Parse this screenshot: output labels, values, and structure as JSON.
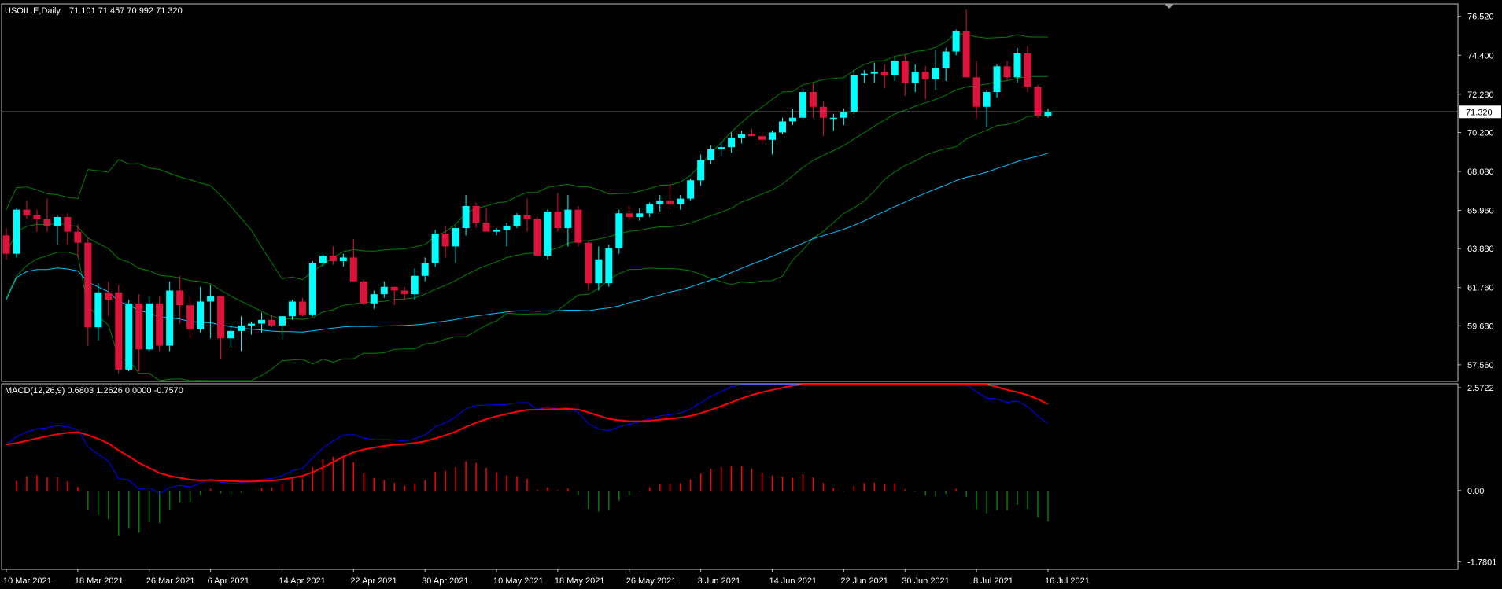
{
  "header": {
    "symbol": "USOIL.E,Daily",
    "ohlc": "71.101 71.457 70.992 71.320"
  },
  "macd_header": {
    "label": "MACD(12,26,9) 0.6803 1.2626 0.0000 -0.7570"
  },
  "colors": {
    "background": "#000000",
    "bull_candle": "#00ffff",
    "bear_candle": "#dc143c",
    "bands": "#008000",
    "ma": "#00bfff",
    "macd_line": "#0000ff",
    "signal_line": "#ff0000",
    "hist_pos": "#ff0000",
    "hist_neg": "#008000",
    "price_line": "#c0c0c0"
  },
  "chart_data": [
    {
      "type": "candlestick",
      "title": "USOIL.E,Daily",
      "price_axis_ticks": [
        "76.520",
        "74.400",
        "72.280",
        "70.200",
        "68.080",
        "65.960",
        "63.880",
        "61.760",
        "59.680",
        "57.560"
      ],
      "ylim": [
        56.7,
        77.15
      ],
      "current_price": "71.320",
      "date_labels": [
        "10 Mar 2021",
        "18 Mar 2021",
        "26 Mar 2021",
        "6 Apr 2021",
        "14 Apr 2021",
        "22 Apr 2021",
        "30 Apr 2021",
        "10 May 2021",
        "18 May 2021",
        "26 May 2021",
        "3 Jun 2021",
        "14 Jun 2021",
        "22 Jun 2021",
        "30 Jun 2021",
        "8 Jul 2021",
        "16 Jul 2021"
      ],
      "candles": [
        [
          64.6,
          65.0,
          63.3,
          63.6
        ],
        [
          63.6,
          66.1,
          63.4,
          66.0
        ],
        [
          66.0,
          66.5,
          65.5,
          65.7
        ],
        [
          65.7,
          66.0,
          64.8,
          65.5
        ],
        [
          65.5,
          66.6,
          64.8,
          65.1
        ],
        [
          65.1,
          65.7,
          64.1,
          65.6
        ],
        [
          65.6,
          65.8,
          64.1,
          64.8
        ],
        [
          64.8,
          65.2,
          63.4,
          64.2
        ],
        [
          64.2,
          64.5,
          58.6,
          59.6
        ],
        [
          59.6,
          62.0,
          58.9,
          61.5
        ],
        [
          61.5,
          62.1,
          60.2,
          61.1
        ],
        [
          61.5,
          61.9,
          57.1,
          57.3
        ],
        [
          57.3,
          61.1,
          57.2,
          60.9
        ],
        [
          60.9,
          61.4,
          57.2,
          58.4
        ],
        [
          58.4,
          61.3,
          58.3,
          60.9
        ],
        [
          60.9,
          61.3,
          58.3,
          58.6
        ],
        [
          58.6,
          62.1,
          58.3,
          61.6
        ],
        [
          61.6,
          62.4,
          59.8,
          60.8
        ],
        [
          60.8,
          61.3,
          59.0,
          59.5
        ],
        [
          59.5,
          61.8,
          59.3,
          61.0
        ],
        [
          61.0,
          61.9,
          59.0,
          61.3
        ],
        [
          61.3,
          61.3,
          57.9,
          59.0
        ],
        [
          59.0,
          59.7,
          58.5,
          59.4
        ],
        [
          59.4,
          60.2,
          58.3,
          59.7
        ],
        [
          59.7,
          59.9,
          59.2,
          59.8
        ],
        [
          59.8,
          60.4,
          59.3,
          60.0
        ],
        [
          60.0,
          60.3,
          59.6,
          59.7
        ],
        [
          59.7,
          60.2,
          59.0,
          60.2
        ],
        [
          60.2,
          61.1,
          60.0,
          61.0
        ],
        [
          61.0,
          61.2,
          60.2,
          60.3
        ],
        [
          60.3,
          63.2,
          60.2,
          63.1
        ],
        [
          63.1,
          63.6,
          62.9,
          63.5
        ],
        [
          63.5,
          64.0,
          63.0,
          63.2
        ],
        [
          63.2,
          63.6,
          62.9,
          63.4
        ],
        [
          63.4,
          64.4,
          62.3,
          62.1
        ],
        [
          62.1,
          62.2,
          60.8,
          60.9
        ],
        [
          60.9,
          61.6,
          60.6,
          61.4
        ],
        [
          61.4,
          62.1,
          61.2,
          61.8
        ],
        [
          61.8,
          61.8,
          60.8,
          61.6
        ],
        [
          61.6,
          61.8,
          61.1,
          61.4
        ],
        [
          61.4,
          62.8,
          61.1,
          62.4
        ],
        [
          62.4,
          63.4,
          62.1,
          63.1
        ],
        [
          63.1,
          64.9,
          62.9,
          64.7
        ],
        [
          64.7,
          65.1,
          63.4,
          64.0
        ],
        [
          64.0,
          65.1,
          63.1,
          65.0
        ],
        [
          65.0,
          66.8,
          64.6,
          66.2
        ],
        [
          66.2,
          66.4,
          65.0,
          65.3
        ],
        [
          65.3,
          66.1,
          65.0,
          64.8
        ],
        [
          64.8,
          65.0,
          64.6,
          64.9
        ],
        [
          64.9,
          65.3,
          64.0,
          65.1
        ],
        [
          65.1,
          65.8,
          65.0,
          65.7
        ],
        [
          65.7,
          66.6,
          64.8,
          65.5
        ],
        [
          65.5,
          65.6,
          63.5,
          63.5
        ],
        [
          63.5,
          66.0,
          63.3,
          65.9
        ],
        [
          65.9,
          66.9,
          64.8,
          65.0
        ],
        [
          65.0,
          66.8,
          64.0,
          66.0
        ],
        [
          66.0,
          66.2,
          64.0,
          64.2
        ],
        [
          64.2,
          64.3,
          61.6,
          62.0
        ],
        [
          62.0,
          64.0,
          61.6,
          63.3
        ],
        [
          62.0,
          64.1,
          61.8,
          63.9
        ],
        [
          63.9,
          66.0,
          63.6,
          65.8
        ],
        [
          65.8,
          66.2,
          65.4,
          65.6
        ],
        [
          65.6,
          66.1,
          65.4,
          65.8
        ],
        [
          65.8,
          66.4,
          65.6,
          66.3
        ],
        [
          66.3,
          66.8,
          65.9,
          66.5
        ],
        [
          66.5,
          67.4,
          66.0,
          66.3
        ],
        [
          66.3,
          66.8,
          66.0,
          66.6
        ],
        [
          66.6,
          67.7,
          66.5,
          67.6
        ],
        [
          67.6,
          69.0,
          67.3,
          68.7
        ],
        [
          68.7,
          69.5,
          68.5,
          69.3
        ],
        [
          69.3,
          69.7,
          68.9,
          69.4
        ],
        [
          69.4,
          70.2,
          69.1,
          69.9
        ],
        [
          69.9,
          70.3,
          69.6,
          70.1
        ],
        [
          70.1,
          70.4,
          70.0,
          70.0
        ],
        [
          70.0,
          70.2,
          69.6,
          69.8
        ],
        [
          69.8,
          70.3,
          69.0,
          70.2
        ],
        [
          70.2,
          71.0,
          70.1,
          70.8
        ],
        [
          70.8,
          71.5,
          70.6,
          71.0
        ],
        [
          71.0,
          72.6,
          70.9,
          72.4
        ],
        [
          72.4,
          72.9,
          71.0,
          71.6
        ],
        [
          71.6,
          71.9,
          70.0,
          71.0
        ],
        [
          71.0,
          71.2,
          70.3,
          71.0
        ],
        [
          71.0,
          71.5,
          70.6,
          71.3
        ],
        [
          71.3,
          73.6,
          71.2,
          73.3
        ],
        [
          73.3,
          73.6,
          72.9,
          73.4
        ],
        [
          73.4,
          74.0,
          72.9,
          73.5
        ],
        [
          73.5,
          73.9,
          72.6,
          73.3
        ],
        [
          73.3,
          74.3,
          73.0,
          74.1
        ],
        [
          74.1,
          74.4,
          72.2,
          72.9
        ],
        [
          72.9,
          73.9,
          72.4,
          73.5
        ],
        [
          73.5,
          73.8,
          72.0,
          73.1
        ],
        [
          73.1,
          74.7,
          72.5,
          73.7
        ],
        [
          73.7,
          74.8,
          73.0,
          74.6
        ],
        [
          74.6,
          75.8,
          74.4,
          75.7
        ],
        [
          75.7,
          76.9,
          73.4,
          73.2
        ],
        [
          73.2,
          74.1,
          71.0,
          71.6
        ],
        [
          71.6,
          72.5,
          70.5,
          72.4
        ],
        [
          72.4,
          73.9,
          72.1,
          73.8
        ],
        [
          73.8,
          74.1,
          73.0,
          73.2
        ],
        [
          73.2,
          74.8,
          72.9,
          74.5
        ],
        [
          74.5,
          74.9,
          72.4,
          72.7
        ],
        [
          72.7,
          72.8,
          71.0,
          71.1
        ],
        [
          71.1,
          71.5,
          71.0,
          71.3
        ]
      ]
    },
    {
      "type": "macd",
      "title": "MACD(12,26,9) 0.6803 1.2626 0.0000 -0.7570",
      "axis_ticks": [
        "2.5722",
        "0.00",
        "-1.7801"
      ],
      "ylim": [
        -1.95,
        2.65
      ]
    }
  ]
}
